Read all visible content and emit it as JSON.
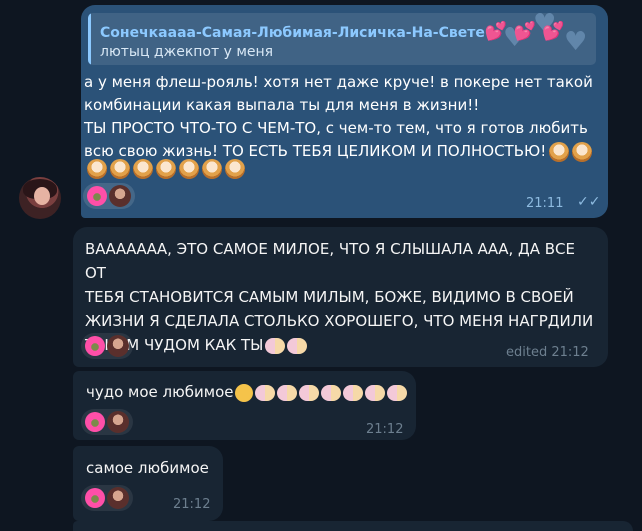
{
  "messages": [
    {
      "id": "m1",
      "direction": "outgoing",
      "reply": {
        "name": "Сонечкаааа-Самая-Любимая-Лисичка-На-Свете",
        "text": "лютыц джекпот у меня"
      },
      "lines": [
        "а у меня флеш-рояль! хотя нет даже круче! в покере нет такой",
        "комбинации какая выпала ты для меня в жизни!!",
        "ТЫ ПРОСТО ЧТО-ТО С ЧЕМ-ТО, с чем-то тем, что я готов любить",
        "всю свою жизнь! ТО ЕСТЬ ТЕБЯ ЦЕЛИКОМ И ПОЛНОСТЬЮ!"
      ],
      "time": "21:11",
      "status": "read"
    },
    {
      "id": "m2",
      "direction": "incoming",
      "lines": [
        "ВААААААА, ЭТО САМОЕ МИЛОЕ, ЧТО Я СЛЫШАЛА ААА, ДА ВСЕ ОТ",
        "ТЕБЯ СТАНОВИТСЯ САМЫМ МИЛЫМ, БОЖЕ, ВИДИМО В СВОЕЙ",
        "ЖИЗНИ Я СДЕЛАЛА СТОЛЬКО ХОРОШЕГО, ЧТО МЕНЯ НАГРДИЛИ",
        "ТАКИМ ЧУДОМ КАК ТЫ"
      ],
      "time": "edited 21:12"
    },
    {
      "id": "m3",
      "direction": "incoming",
      "text": "чудо мое любимое",
      "time": "21:12"
    },
    {
      "id": "m4",
      "direction": "incoming",
      "text": "самое любимое",
      "time": "21:12"
    }
  ],
  "colors": {
    "background": "#0e1621",
    "outgoing_bubble": "#2b5278",
    "incoming_bubble": "#182533",
    "accent": "#8cc9ff"
  }
}
